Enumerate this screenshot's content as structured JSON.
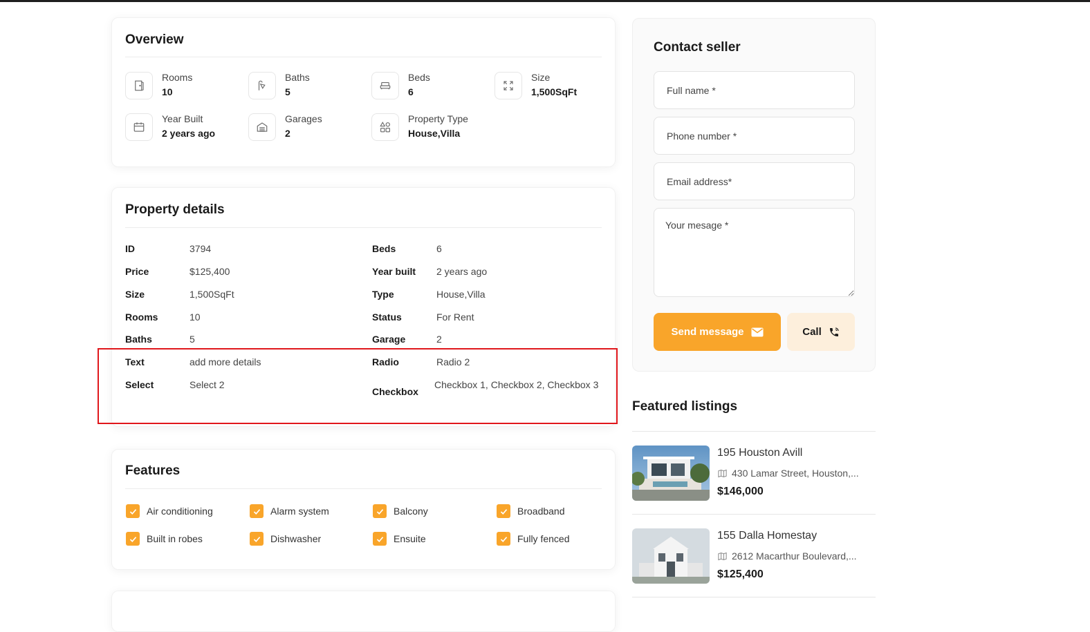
{
  "overview": {
    "title": "Overview",
    "items": [
      {
        "label": "Rooms",
        "value": "10",
        "icon": "door-icon"
      },
      {
        "label": "Baths",
        "value": "5",
        "icon": "shower-icon"
      },
      {
        "label": "Beds",
        "value": "6",
        "icon": "bed-icon"
      },
      {
        "label": "Size",
        "value": "1,500SqFt",
        "icon": "expand-icon"
      },
      {
        "label": "Year Built",
        "value": "2 years ago",
        "icon": "calendar-icon"
      },
      {
        "label": "Garages",
        "value": "2",
        "icon": "garage-icon"
      },
      {
        "label": "Property Type",
        "value": "House,Villa",
        "icon": "shapes-icon"
      }
    ]
  },
  "details": {
    "title": "Property details",
    "left": [
      {
        "key": "ID",
        "value": "3794"
      },
      {
        "key": "Price",
        "value": "$125,400"
      },
      {
        "key": "Size",
        "value": "1,500SqFt"
      },
      {
        "key": "Rooms",
        "value": "10"
      },
      {
        "key": "Baths",
        "value": "5"
      },
      {
        "key": "Text",
        "value": "add more details"
      },
      {
        "key": "Select",
        "value": "Select 2"
      }
    ],
    "right": [
      {
        "key": "Beds",
        "value": "6"
      },
      {
        "key": "Year built",
        "value": "2 years ago"
      },
      {
        "key": "Type",
        "value": "House,Villa"
      },
      {
        "key": "Status",
        "value": "For Rent"
      },
      {
        "key": "Garage",
        "value": "2"
      },
      {
        "key": "Radio",
        "value": "Radio 2"
      },
      {
        "key": "Checkbox",
        "value": "Checkbox 1, Checkbox 2, Checkbox 3"
      }
    ]
  },
  "features": {
    "title": "Features",
    "items": [
      "Air conditioning",
      "Alarm system",
      "Balcony",
      "Broadband",
      "Built in robes",
      "Dishwasher",
      "Ensuite",
      "Fully fenced"
    ]
  },
  "contact": {
    "title": "Contact seller",
    "fullname_placeholder": "Full name *",
    "phone_placeholder": "Phone number *",
    "email_placeholder": "Email address*",
    "message_placeholder": "Your mesage *",
    "send_label": "Send message",
    "call_label": "Call"
  },
  "featured": {
    "title": "Featured listings",
    "listings": [
      {
        "title": "195 Houston Avill",
        "address": "430 Lamar Street, Houston,...",
        "price": "$146,000"
      },
      {
        "title": "155 Dalla Homestay",
        "address": "2612 Macarthur Boulevard,...",
        "price": "$125,400"
      }
    ]
  },
  "colors": {
    "accent": "#f9a52a",
    "highlight": "#e0161b",
    "call_bg": "#fdefdc"
  }
}
